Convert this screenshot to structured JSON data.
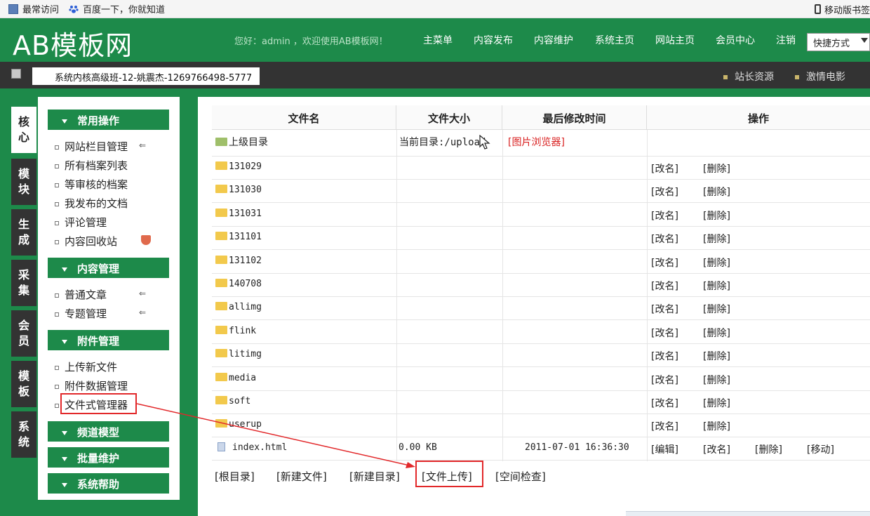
{
  "bookmarks": {
    "frequent": "最常访问",
    "baidu": "百度一下，你就知道",
    "mobile": "移动版书签"
  },
  "header": {
    "logo": "AB模板网",
    "welcome": "您好：admin ，欢迎使用AB模板网！",
    "nav": [
      "主菜单",
      "内容发布",
      "内容维护",
      "系统主页",
      "网站主页",
      "会员中心",
      "注销"
    ],
    "quick": "快捷方式"
  },
  "darkbar": {
    "overlay_text": "系统内核高级班-12-姚震杰-1269766498-5777",
    "links": [
      "站长资源",
      "激情电影"
    ]
  },
  "vtabs": [
    "核心",
    "模块",
    "生成",
    "采集",
    "会员",
    "模板",
    "系统"
  ],
  "menu": {
    "sections": [
      "常用操作",
      "内容管理",
      "附件管理",
      "频道模型",
      "批量维护",
      "系统帮助"
    ],
    "common": [
      "网站栏目管理",
      "所有档案列表",
      "等审核的档案",
      "我发布的文档",
      "评论管理",
      "内容回收站"
    ],
    "content": [
      "普通文章",
      "专题管理"
    ],
    "attach": [
      "上传新文件",
      "附件数据管理",
      "文件式管理器"
    ]
  },
  "table": {
    "headers": [
      "文件名",
      "文件大小",
      "最后修改时间",
      "操作"
    ],
    "parent": {
      "name": "上级目录",
      "current": "当前目录:/upload",
      "viewer": "[图片浏览器]"
    },
    "folders": [
      "131029",
      "131030",
      "131031",
      "131101",
      "131102",
      "140708",
      "allimg",
      "flink",
      "litimg",
      "media",
      "soft",
      "userup"
    ],
    "folder_ops": {
      "rename": "[改名]",
      "delete": "[删除]"
    },
    "file": {
      "name": "index.html",
      "size": "0.00 KB",
      "time": "2011-07-01 16:36:30",
      "ops": [
        "[编辑]",
        "[改名]",
        "[删除]",
        "[移动]"
      ]
    }
  },
  "bottom": [
    "[根目录]",
    "[新建文件]",
    "[新建目录]",
    "[文件上传]",
    "[空间检查]"
  ],
  "colors": {
    "brand_green": "#1d8a4a",
    "dark_bar": "#333333",
    "highlight": "#e2282a"
  }
}
